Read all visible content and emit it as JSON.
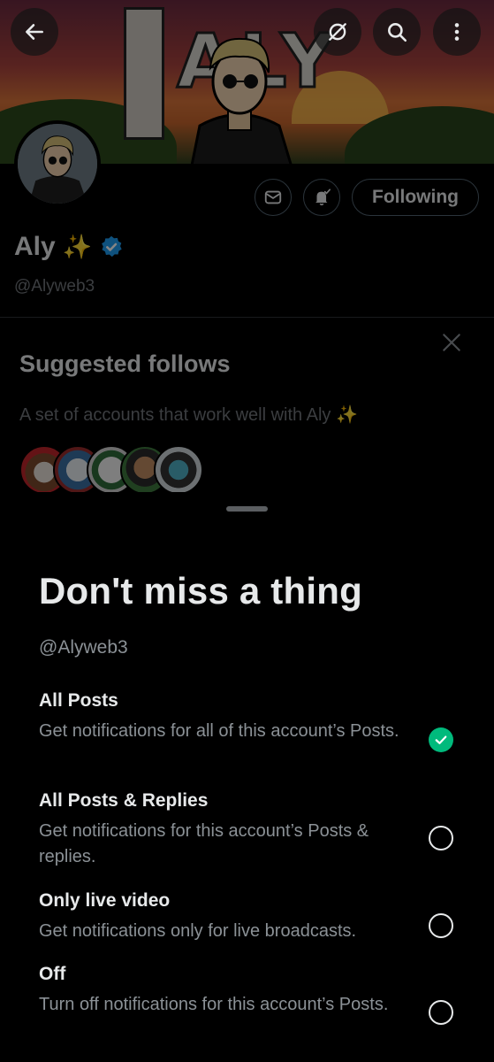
{
  "profile": {
    "display_name": "Aly",
    "name_emoji": "✨",
    "handle": "@Alyweb3",
    "following_label": "Following",
    "banner_text": "ALY",
    "icons": {
      "back": "arrow-left-icon",
      "grok": "grok-icon",
      "search": "search-icon",
      "more": "more-vertical-icon",
      "message": "envelope-icon",
      "notifications": "bell-check-icon",
      "verified": "verified-badge-icon"
    }
  },
  "suggested": {
    "title": "Suggested follows",
    "subtitle": "A set of accounts that work well with Aly ✨",
    "avatar_count": 5
  },
  "sheet": {
    "title": "Don't miss a thing",
    "handle": "@Alyweb3",
    "options": [
      {
        "title": "All Posts",
        "desc": "Get notifications for all of this account’s Posts.",
        "selected": true
      },
      {
        "title": "All Posts & Replies",
        "desc": "Get notifications for this account’s Posts & replies.",
        "selected": false
      },
      {
        "title": "Only live video",
        "desc": "Get notifications only for live broadcasts.",
        "selected": false
      },
      {
        "title": "Off",
        "desc": "Turn off notifications for this account’s Posts.",
        "selected": false
      }
    ]
  },
  "colors": {
    "background": "#000000",
    "primary_text": "#e7e9ea",
    "secondary_text": "#8b9196",
    "verified_blue": "#1d9bf0",
    "selected_green": "#00ba7c",
    "border": "#536471"
  }
}
